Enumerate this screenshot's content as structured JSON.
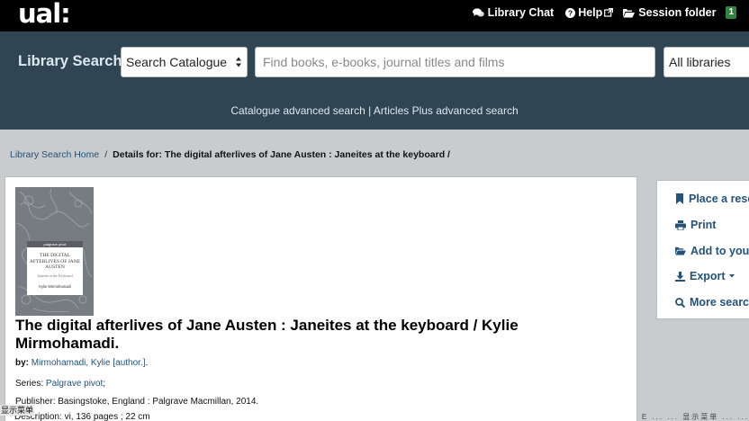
{
  "topbar": {
    "logo": "ual:",
    "chat_label": "Library Chat",
    "help_label": "Help",
    "session_label": "Session folder",
    "session_count": "1"
  },
  "search": {
    "title": "Library Search",
    "catalogue_select": "Search Catalogue",
    "placeholder": "Find books, e-books, journal titles and films",
    "libraries_select": "All libraries",
    "adv_catalogue": "Catalogue advanced search",
    "adv_separator": "|",
    "adv_articles": "Articles Plus advanced search"
  },
  "breadcrumb": {
    "home": "Library Search Home",
    "separator": "/",
    "current": "Details for: The digital afterlives of Jane Austen : Janeites at the keyboard /"
  },
  "record": {
    "title": "The digital afterlives of Jane Austen : Janeites at the keyboard / Kylie Mirmohamadi.",
    "by_label": "by:",
    "author": "Mirmohamadi, Kylie [author.]",
    "author_tail": ".",
    "series_label": "Series:",
    "series": "Palgrave pivot",
    "series_tail": ";",
    "publisher_label": "Publisher:",
    "publisher": "Basingstoke, England : Palgrave Macmillan, 2014.",
    "description_line": "Description: vi, 136 pages ; 22 cm",
    "cover": {
      "brand": "palgrave pivot",
      "title": "THE DIGITAL AFTERLIVES OF JANE AUSTEN",
      "subtitle": "Janeites at the Keyboard",
      "author": "Kylie Mirmohamadi"
    }
  },
  "actions": [
    {
      "label": "Place a rese",
      "icon": "bookmark-icon"
    },
    {
      "label": "Print",
      "icon": "print-icon"
    },
    {
      "label": "Add to your",
      "icon": "folder-open-icon"
    },
    {
      "label": "Export",
      "icon": "download-icon"
    },
    {
      "label": "More search",
      "icon": "search-icon"
    }
  ],
  "bottom": {
    "left": "显示菜单",
    "right": "E ... ... 显示菜单 ... ..."
  },
  "colors": {
    "topbar": "#000000",
    "band": "#2f4553",
    "page": "#c9cccf",
    "link": "#24527a",
    "badge": "#2e8540"
  }
}
